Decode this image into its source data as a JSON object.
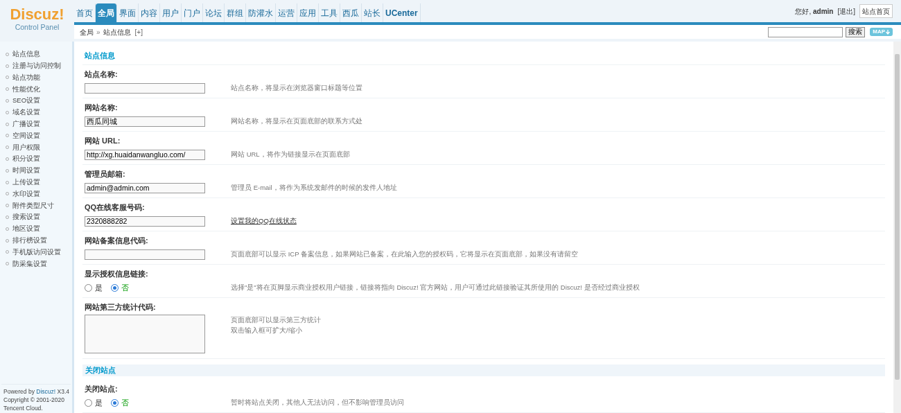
{
  "header": {
    "logo": {
      "title": "Discuz!",
      "subtitle": "Control Panel"
    },
    "nav": [
      {
        "label": "首页",
        "selected": false
      },
      {
        "label": "全局",
        "selected": true
      },
      {
        "label": "界面",
        "selected": false
      },
      {
        "label": "内容",
        "selected": false
      },
      {
        "label": "用户",
        "selected": false
      },
      {
        "label": "门户",
        "selected": false
      },
      {
        "label": "论坛",
        "selected": false
      },
      {
        "label": "群组",
        "selected": false
      },
      {
        "label": "防灌水",
        "selected": false
      },
      {
        "label": "运营",
        "selected": false
      },
      {
        "label": "应用",
        "selected": false
      },
      {
        "label": "工具",
        "selected": false
      },
      {
        "label": "西瓜",
        "selected": false
      },
      {
        "label": "站长",
        "selected": false
      },
      {
        "label": "UCenter",
        "selected": false
      }
    ],
    "greeting": "您好,",
    "username": "admin",
    "logout": "[退出]",
    "home_button": "站点首页"
  },
  "breadcrumb": {
    "items": [
      "全局",
      "站点信息"
    ],
    "separator": "»",
    "add": "[+]",
    "search_button": "搜索",
    "map_button": "MAP"
  },
  "sidebar": {
    "items": [
      "站点信息",
      "注册与访问控制",
      "站点功能",
      "性能优化",
      "SEO设置",
      "域名设置",
      "广播设置",
      "空间设置",
      "用户权限",
      "积分设置",
      "时间设置",
      "上传设置",
      "水印设置",
      "附件类型尺寸",
      "搜索设置",
      "地区设置",
      "排行榜设置",
      "手机版访问设置",
      "防采集设置"
    ],
    "footer": {
      "prefix": "Powered by",
      "link": "Discuz!",
      "version": "X3.4",
      "copyright": "Copyright © 2001-2020",
      "company": "Tencent Cloud."
    }
  },
  "form": {
    "title": "站点信息",
    "rows": [
      {
        "kind": "text",
        "label": "站点名称:",
        "hint": "站点名称，将显示在浏览器窗口标题等位置"
      },
      {
        "kind": "text",
        "label": "网站名称:",
        "value": "西瓜同城",
        "hint": "网站名称，将显示在页面底部的联系方式处"
      },
      {
        "kind": "text",
        "label": "网站 URL:",
        "value": "http://xg.huaidanwangluo.com/",
        "hint": "网站 URL，将作为链接显示在页面底部"
      },
      {
        "kind": "text",
        "label": "管理员邮箱:",
        "value": "admin@admin.com",
        "hint": "管理员 E-mail，将作为系统发邮件的时候的发件人地址"
      },
      {
        "kind": "text",
        "label": "QQ在线客服号码:",
        "value": "2320888282",
        "link": "设置我的QQ在线状态"
      },
      {
        "kind": "text",
        "label": "网站备案信息代码:",
        "hint": "页面底部可以显示 ICP 备案信息，如果网站已备案，在此输入您的授权码，它将显示在页面底部，如果没有请留空"
      },
      {
        "kind": "radio",
        "label": "显示授权信息链接:",
        "options": [
          {
            "label": "是",
            "selected": false
          },
          {
            "label": "否",
            "selected": true
          }
        ],
        "hint": "选择\"是\"将在页脚显示商业授权用户链接，链接将指向 Discuz! 官方网站，用户可通过此链接验证其所使用的 Discuz! 是否经过商业授权"
      },
      {
        "kind": "textarea",
        "label": "网站第三方统计代码:",
        "hint_lines": [
          "页面底部可以显示第三方统计",
          "双击输入框可扩大/缩小"
        ]
      },
      {
        "kind": "section",
        "label": "关闭站点"
      },
      {
        "kind": "radio",
        "label": "关闭站点:",
        "options": [
          {
            "label": "是",
            "selected": false
          },
          {
            "label": "否",
            "selected": true
          }
        ],
        "hint": "暂时将站点关闭，其他人无法访问，但不影响管理员访问"
      }
    ]
  }
}
